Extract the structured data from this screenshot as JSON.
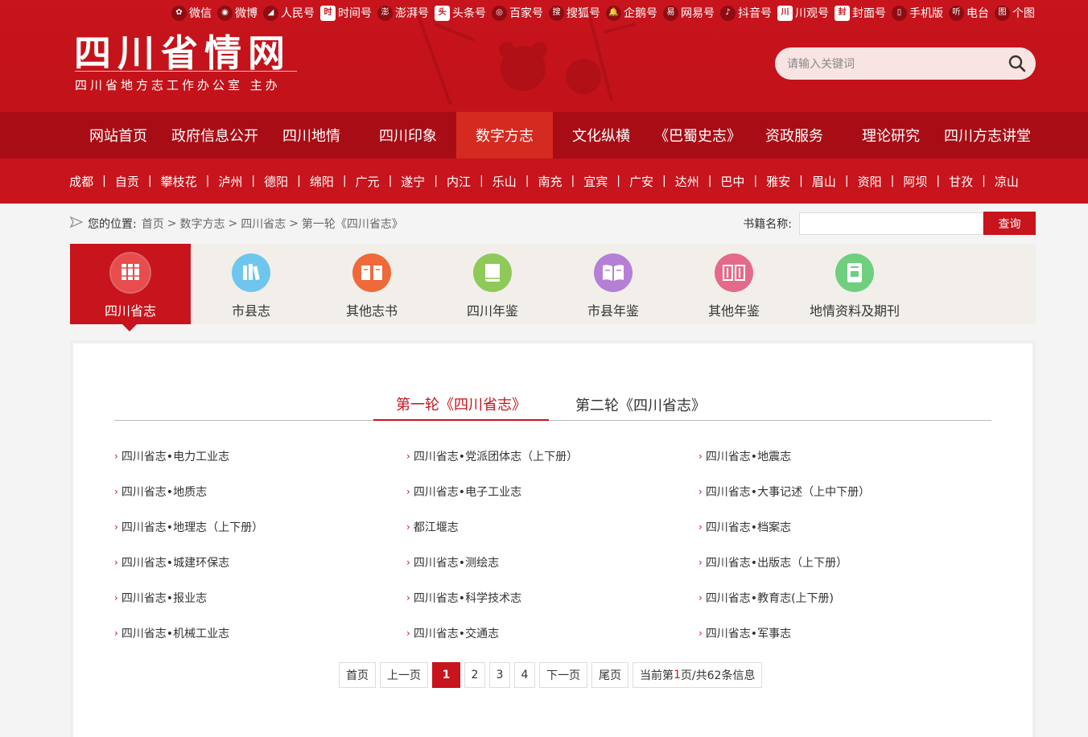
{
  "top_links": [
    {
      "label": "微信",
      "icon": "wechat-icon",
      "glyph": "✿"
    },
    {
      "label": "微博",
      "icon": "weibo-icon",
      "glyph": "◉"
    },
    {
      "label": "人民号",
      "icon": "renmin-icon",
      "glyph": "◢"
    },
    {
      "label": "时间号",
      "icon": "shijian-icon",
      "glyph": "时"
    },
    {
      "label": "澎湃号",
      "icon": "pengpai-icon",
      "glyph": "澎"
    },
    {
      "label": "头条号",
      "icon": "toutiao-icon",
      "glyph": "头"
    },
    {
      "label": "百家号",
      "icon": "baijia-icon",
      "glyph": "◎"
    },
    {
      "label": "搜狐号",
      "icon": "sohu-icon",
      "glyph": "搜"
    },
    {
      "label": "企鹅号",
      "icon": "penguin-icon",
      "glyph": "🔔"
    },
    {
      "label": "网易号",
      "icon": "netease-icon",
      "glyph": "易"
    },
    {
      "label": "抖音号",
      "icon": "douyin-icon",
      "glyph": "♪"
    },
    {
      "label": "川观号",
      "icon": "chuanguan-icon",
      "glyph": "川"
    },
    {
      "label": "封面号",
      "icon": "fengmian-icon",
      "glyph": "封"
    },
    {
      "label": "手机版",
      "icon": "mobile-icon",
      "glyph": "▯"
    },
    {
      "label": "电台",
      "icon": "radio-icon",
      "glyph": "听"
    },
    {
      "label": "个图",
      "icon": "getu-icon",
      "glyph": "图"
    }
  ],
  "logo": {
    "title": "四川省情网",
    "subtitle": "四川省地方志工作办公室  主办"
  },
  "search": {
    "placeholder": "请输入关键词"
  },
  "main_nav": [
    "网站首页",
    "政府信息公开",
    "四川地情",
    "四川印象",
    "数字方志",
    "文化纵横",
    "《巴蜀史志》",
    "资政服务",
    "理论研究",
    "四川方志讲堂"
  ],
  "main_nav_active": 4,
  "cities": [
    "成都",
    "自贡",
    "攀枝花",
    "泸州",
    "德阳",
    "绵阳",
    "广元",
    "遂宁",
    "内江",
    "乐山",
    "南充",
    "宜宾",
    "广安",
    "达州",
    "巴中",
    "雅安",
    "眉山",
    "资阳",
    "阿坝",
    "甘孜",
    "凉山"
  ],
  "breadcrumb": {
    "label": "您的位置:",
    "items": [
      "首页",
      "数字方志",
      "四川省志",
      "第一轮《四川省志》"
    ]
  },
  "book_search": {
    "label": "书籍名称:",
    "value": "",
    "button": "查询"
  },
  "categories": [
    {
      "label": "四川省志",
      "icon": "books-icon",
      "color": "#e84c4c",
      "active": true
    },
    {
      "label": "市县志",
      "icon": "volumes-icon",
      "color": "#6ec6ee",
      "active": false
    },
    {
      "label": "其他志书",
      "icon": "open-book-icon",
      "color": "#ee6a3a",
      "active": false
    },
    {
      "label": "四川年鉴",
      "icon": "book-icon",
      "color": "#8fc95a",
      "active": false
    },
    {
      "label": "市县年鉴",
      "icon": "reading-icon",
      "color": "#b67fd6",
      "active": false
    },
    {
      "label": "其他年鉴",
      "icon": "journal-icon",
      "color": "#e46a8c",
      "active": false
    },
    {
      "label": "地情资料及期刊",
      "icon": "archive-icon",
      "color": "#6fcf7f",
      "active": false
    }
  ],
  "tabs": [
    "第一轮《四川省志》",
    "第二轮《四川省志》"
  ],
  "books": [
    "四川省志•电力工业志",
    "四川省志•党派团体志（上下册）",
    "四川省志•地震志",
    "四川省志•地质志",
    "四川省志•电子工业志",
    "四川省志•大事记述（上中下册）",
    "四川省志•地理志（上下册）",
    "都江堰志",
    "四川省志•档案志",
    "四川省志•城建环保志",
    "四川省志•测绘志",
    "四川省志•出版志（上下册）",
    "四川省志•报业志",
    "四川省志•科学技术志",
    "四川省志•教育志(上下册)",
    "四川省志•机械工业志",
    "四川省志•交通志",
    "四川省志•军事志"
  ],
  "pagination": {
    "first": "首页",
    "prev": "上一页",
    "pages": [
      "1",
      "2",
      "3",
      "4"
    ],
    "current": "1",
    "next": "下一页",
    "last": "尾页",
    "info_prefix": "当前第",
    "info_page": "1",
    "info_suffix": "页/共62条信息"
  },
  "colors": {
    "brand_red": "#c8141c",
    "nav_dark": "#a80d15",
    "nav_active": "#d42a1f"
  }
}
